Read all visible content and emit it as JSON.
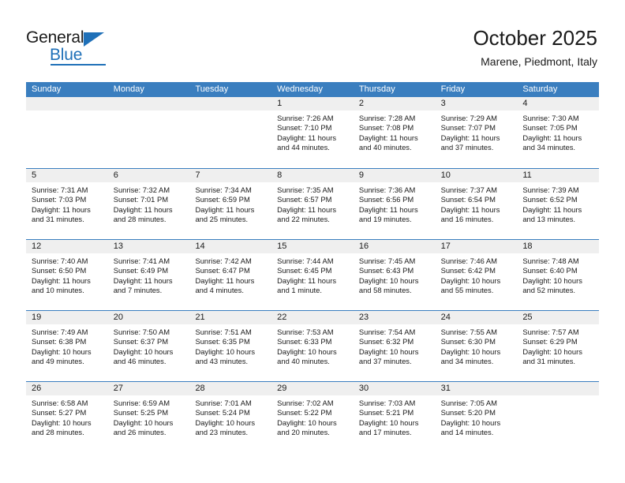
{
  "brand": {
    "name_part1": "General",
    "name_part2": "Blue",
    "triangle_color": "#1f70b8",
    "accent_color": "#3a7ebf"
  },
  "header": {
    "title": "October 2025",
    "subtitle": "Marene, Piedmont, Italy"
  },
  "calendar": {
    "weekday_headers": [
      "Sunday",
      "Monday",
      "Tuesday",
      "Wednesday",
      "Thursday",
      "Friday",
      "Saturday"
    ],
    "header_bg": "#3a7ebf",
    "daynum_band_bg": "#efefef",
    "weeks": [
      [
        {
          "day": "",
          "empty": true
        },
        {
          "day": "",
          "empty": true
        },
        {
          "day": "",
          "empty": true
        },
        {
          "day": "1",
          "sunrise": "Sunrise: 7:26 AM",
          "sunset": "Sunset: 7:10 PM",
          "daylight_1": "Daylight: 11 hours",
          "daylight_2": "and 44 minutes."
        },
        {
          "day": "2",
          "sunrise": "Sunrise: 7:28 AM",
          "sunset": "Sunset: 7:08 PM",
          "daylight_1": "Daylight: 11 hours",
          "daylight_2": "and 40 minutes."
        },
        {
          "day": "3",
          "sunrise": "Sunrise: 7:29 AM",
          "sunset": "Sunset: 7:07 PM",
          "daylight_1": "Daylight: 11 hours",
          "daylight_2": "and 37 minutes."
        },
        {
          "day": "4",
          "sunrise": "Sunrise: 7:30 AM",
          "sunset": "Sunset: 7:05 PM",
          "daylight_1": "Daylight: 11 hours",
          "daylight_2": "and 34 minutes."
        }
      ],
      [
        {
          "day": "5",
          "sunrise": "Sunrise: 7:31 AM",
          "sunset": "Sunset: 7:03 PM",
          "daylight_1": "Daylight: 11 hours",
          "daylight_2": "and 31 minutes."
        },
        {
          "day": "6",
          "sunrise": "Sunrise: 7:32 AM",
          "sunset": "Sunset: 7:01 PM",
          "daylight_1": "Daylight: 11 hours",
          "daylight_2": "and 28 minutes."
        },
        {
          "day": "7",
          "sunrise": "Sunrise: 7:34 AM",
          "sunset": "Sunset: 6:59 PM",
          "daylight_1": "Daylight: 11 hours",
          "daylight_2": "and 25 minutes."
        },
        {
          "day": "8",
          "sunrise": "Sunrise: 7:35 AM",
          "sunset": "Sunset: 6:57 PM",
          "daylight_1": "Daylight: 11 hours",
          "daylight_2": "and 22 minutes."
        },
        {
          "day": "9",
          "sunrise": "Sunrise: 7:36 AM",
          "sunset": "Sunset: 6:56 PM",
          "daylight_1": "Daylight: 11 hours",
          "daylight_2": "and 19 minutes."
        },
        {
          "day": "10",
          "sunrise": "Sunrise: 7:37 AM",
          "sunset": "Sunset: 6:54 PM",
          "daylight_1": "Daylight: 11 hours",
          "daylight_2": "and 16 minutes."
        },
        {
          "day": "11",
          "sunrise": "Sunrise: 7:39 AM",
          "sunset": "Sunset: 6:52 PM",
          "daylight_1": "Daylight: 11 hours",
          "daylight_2": "and 13 minutes."
        }
      ],
      [
        {
          "day": "12",
          "sunrise": "Sunrise: 7:40 AM",
          "sunset": "Sunset: 6:50 PM",
          "daylight_1": "Daylight: 11 hours",
          "daylight_2": "and 10 minutes."
        },
        {
          "day": "13",
          "sunrise": "Sunrise: 7:41 AM",
          "sunset": "Sunset: 6:49 PM",
          "daylight_1": "Daylight: 11 hours",
          "daylight_2": "and 7 minutes."
        },
        {
          "day": "14",
          "sunrise": "Sunrise: 7:42 AM",
          "sunset": "Sunset: 6:47 PM",
          "daylight_1": "Daylight: 11 hours",
          "daylight_2": "and 4 minutes."
        },
        {
          "day": "15",
          "sunrise": "Sunrise: 7:44 AM",
          "sunset": "Sunset: 6:45 PM",
          "daylight_1": "Daylight: 11 hours",
          "daylight_2": "and 1 minute."
        },
        {
          "day": "16",
          "sunrise": "Sunrise: 7:45 AM",
          "sunset": "Sunset: 6:43 PM",
          "daylight_1": "Daylight: 10 hours",
          "daylight_2": "and 58 minutes."
        },
        {
          "day": "17",
          "sunrise": "Sunrise: 7:46 AM",
          "sunset": "Sunset: 6:42 PM",
          "daylight_1": "Daylight: 10 hours",
          "daylight_2": "and 55 minutes."
        },
        {
          "day": "18",
          "sunrise": "Sunrise: 7:48 AM",
          "sunset": "Sunset: 6:40 PM",
          "daylight_1": "Daylight: 10 hours",
          "daylight_2": "and 52 minutes."
        }
      ],
      [
        {
          "day": "19",
          "sunrise": "Sunrise: 7:49 AM",
          "sunset": "Sunset: 6:38 PM",
          "daylight_1": "Daylight: 10 hours",
          "daylight_2": "and 49 minutes."
        },
        {
          "day": "20",
          "sunrise": "Sunrise: 7:50 AM",
          "sunset": "Sunset: 6:37 PM",
          "daylight_1": "Daylight: 10 hours",
          "daylight_2": "and 46 minutes."
        },
        {
          "day": "21",
          "sunrise": "Sunrise: 7:51 AM",
          "sunset": "Sunset: 6:35 PM",
          "daylight_1": "Daylight: 10 hours",
          "daylight_2": "and 43 minutes."
        },
        {
          "day": "22",
          "sunrise": "Sunrise: 7:53 AM",
          "sunset": "Sunset: 6:33 PM",
          "daylight_1": "Daylight: 10 hours",
          "daylight_2": "and 40 minutes."
        },
        {
          "day": "23",
          "sunrise": "Sunrise: 7:54 AM",
          "sunset": "Sunset: 6:32 PM",
          "daylight_1": "Daylight: 10 hours",
          "daylight_2": "and 37 minutes."
        },
        {
          "day": "24",
          "sunrise": "Sunrise: 7:55 AM",
          "sunset": "Sunset: 6:30 PM",
          "daylight_1": "Daylight: 10 hours",
          "daylight_2": "and 34 minutes."
        },
        {
          "day": "25",
          "sunrise": "Sunrise: 7:57 AM",
          "sunset": "Sunset: 6:29 PM",
          "daylight_1": "Daylight: 10 hours",
          "daylight_2": "and 31 minutes."
        }
      ],
      [
        {
          "day": "26",
          "sunrise": "Sunrise: 6:58 AM",
          "sunset": "Sunset: 5:27 PM",
          "daylight_1": "Daylight: 10 hours",
          "daylight_2": "and 28 minutes."
        },
        {
          "day": "27",
          "sunrise": "Sunrise: 6:59 AM",
          "sunset": "Sunset: 5:25 PM",
          "daylight_1": "Daylight: 10 hours",
          "daylight_2": "and 26 minutes."
        },
        {
          "day": "28",
          "sunrise": "Sunrise: 7:01 AM",
          "sunset": "Sunset: 5:24 PM",
          "daylight_1": "Daylight: 10 hours",
          "daylight_2": "and 23 minutes."
        },
        {
          "day": "29",
          "sunrise": "Sunrise: 7:02 AM",
          "sunset": "Sunset: 5:22 PM",
          "daylight_1": "Daylight: 10 hours",
          "daylight_2": "and 20 minutes."
        },
        {
          "day": "30",
          "sunrise": "Sunrise: 7:03 AM",
          "sunset": "Sunset: 5:21 PM",
          "daylight_1": "Daylight: 10 hours",
          "daylight_2": "and 17 minutes."
        },
        {
          "day": "31",
          "sunrise": "Sunrise: 7:05 AM",
          "sunset": "Sunset: 5:20 PM",
          "daylight_1": "Daylight: 10 hours",
          "daylight_2": "and 14 minutes."
        },
        {
          "day": "",
          "empty": true
        }
      ]
    ]
  }
}
